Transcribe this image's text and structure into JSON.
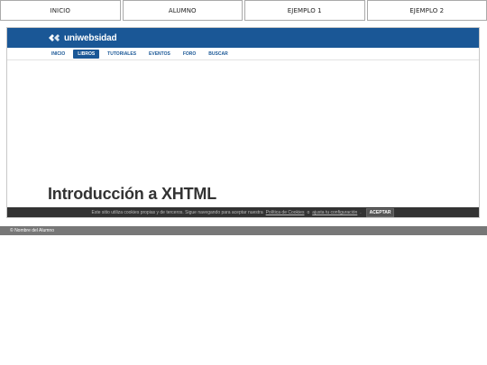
{
  "top_tabs": [
    "INICIO",
    "ALUMNO",
    "EJEMPLO 1",
    "EJEMPLO 2"
  ],
  "site": {
    "logo_text": "uniwebsidad",
    "menu": [
      "INICIO",
      "LIBROS",
      "TUTORIALES",
      "EVENTOS",
      "FORO",
      "BUSCAR"
    ],
    "active_menu": "LIBROS",
    "page_title": "Introducción a XHTML",
    "cookie": {
      "text": "Este sitio utiliza cookies propias y de terceros. Sigue navegando para aceptar nuestra",
      "policy_link": "Política de Cookies",
      "or": "o",
      "config_link": "ajusta tu configuración",
      "end": ".",
      "accept": "ACEPTAR"
    }
  },
  "footer": {
    "text": "© Nombre del Alumno"
  },
  "colors": {
    "brand_blue": "#1a5796",
    "cookie_bar": "#333333",
    "footer": "#777777"
  },
  "icons": {
    "logo_mark": "double-chevron-logo-icon"
  }
}
